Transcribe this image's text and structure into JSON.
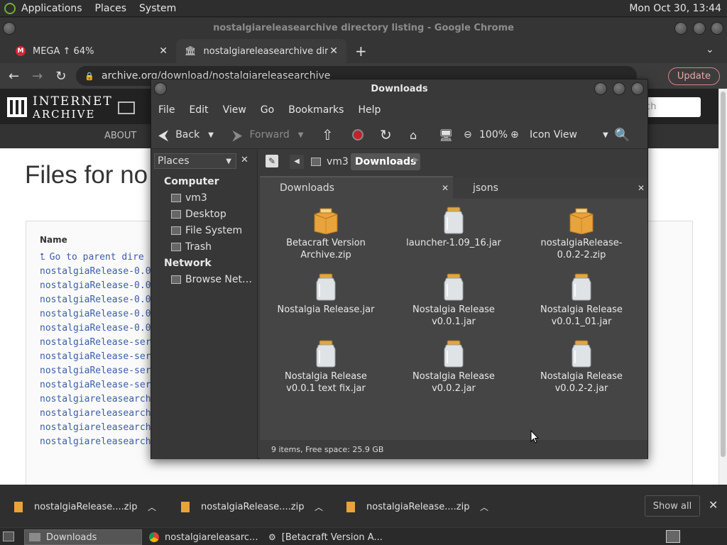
{
  "topbar": {
    "menu": [
      "Applications",
      "Places",
      "System"
    ],
    "clock": "Mon Oct 30, 13:44"
  },
  "chrome": {
    "title": "nostalgiareleasearchive directory listing - Google Chrome",
    "tabs": [
      {
        "label": "MEGA ↑ 64%"
      },
      {
        "label": "nostalgiareleasearchive direct"
      }
    ],
    "url": "archive.org/download/nostalgiareleasearchive",
    "update_label": "Update"
  },
  "page": {
    "logo_line1": "INTERNET",
    "logo_line2": "ARCHIVE",
    "search_placeholder": "rch",
    "nav_about": "ABOUT",
    "heading": "Files for no",
    "col_name": "Name",
    "parent_link": "Go to parent dire",
    "rows": [
      "nostalgiaRelease-0.0",
      "nostalgiaRelease-0.0",
      "nostalgiaRelease-0.0",
      "nostalgiaRelease-0.0",
      "nostalgiaRelease-0.0",
      "nostalgiaRelease-ser",
      "nostalgiaRelease-ser",
      "nostalgiaRelease-ser",
      "nostalgiaRelease-ser",
      "nostalgiareleasearch",
      "nostalgiareleasearch",
      "nostalgiareleasearch",
      "nostalgiareleasearch"
    ]
  },
  "fm": {
    "title": "Downloads",
    "menu": [
      "File",
      "Edit",
      "View",
      "Go",
      "Bookmarks",
      "Help"
    ],
    "toolbar": {
      "back": "Back",
      "forward": "Forward",
      "zoom": "100%",
      "view": "Icon View"
    },
    "sidebar": {
      "selector": "Places",
      "computer_header": "Computer",
      "computer_items": [
        "vm3",
        "Desktop",
        "File System",
        "Trash"
      ],
      "network_header": "Network",
      "network_items": [
        "Browse Net…"
      ]
    },
    "path": [
      "vm3",
      "Downloads"
    ],
    "tabs": [
      "Downloads",
      "jsons"
    ],
    "files": [
      {
        "name": "Betacraft Version Archive.zip",
        "type": "zip"
      },
      {
        "name": "launcher-1.09_16.jar",
        "type": "jar"
      },
      {
        "name": "nostalgiaRelease-0.0.2-2.zip",
        "type": "zip"
      },
      {
        "name": "Nostalgia Release.jar",
        "type": "jar"
      },
      {
        "name": "Nostalgia Release v0.0.1.jar",
        "type": "jar"
      },
      {
        "name": "Nostalgia Release v0.0.1_01.jar",
        "type": "jar"
      },
      {
        "name": "Nostalgia Release v0.0.1 text fix.jar",
        "type": "jar"
      },
      {
        "name": "Nostalgia Release v0.0.2.jar",
        "type": "jar"
      },
      {
        "name": "Nostalgia Release v0.0.2-2.jar",
        "type": "jar"
      }
    ],
    "status": "9 items, Free space: 25.9 GB"
  },
  "downloads_bar": {
    "items": [
      "nostalgiaRelease....zip",
      "nostalgiaRelease....zip",
      "nostalgiaRelease....zip"
    ],
    "show_all": "Show all"
  },
  "taskbar": {
    "items": [
      "Downloads",
      "nostalgiareleasarc...",
      "[Betacraft Version A..."
    ]
  },
  "colors": {
    "folder": "#e8a33a",
    "link": "#3c5ea8",
    "record": "#c0232c",
    "mega": "#d9272e"
  }
}
